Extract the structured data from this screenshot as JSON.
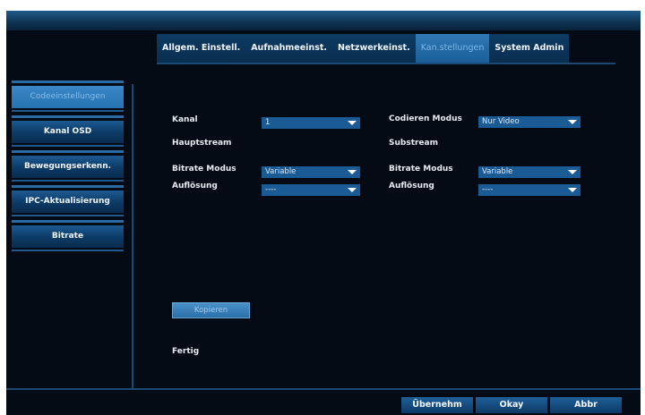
{
  "tabs": [
    {
      "label": "Allgem. Einstell."
    },
    {
      "label": "Aufnahmeeinst."
    },
    {
      "label": "Netzwerkeinst."
    },
    {
      "label": "Kan.stellungen",
      "active": true
    },
    {
      "label": "System Admin"
    }
  ],
  "sidebar": {
    "items": [
      {
        "label": "Codeeinstellungen",
        "active": true
      },
      {
        "label": "Kanal OSD"
      },
      {
        "label": "Bewegungserkenn."
      },
      {
        "label": "IPC-Aktualisierung"
      },
      {
        "label": "Bitrate"
      }
    ]
  },
  "form": {
    "kanal_label": "Kanal",
    "kanal_value": "1",
    "codieren_modus_label": "Codieren Modus",
    "codieren_modus_value": "Nur Video",
    "hauptstream_label": "Hauptstream",
    "substream_label": "Substream",
    "main_bitrate_modus_label": "Bitrate Modus",
    "main_bitrate_modus_value": "Variable",
    "sub_bitrate_modus_label": "Bitrate Modus",
    "sub_bitrate_modus_value": "Variable",
    "main_aufloesung_label": "Auflösung",
    "main_aufloesung_value": "----",
    "sub_aufloesung_label": "Auflösung",
    "sub_aufloesung_value": "----"
  },
  "copy_button": "Kopieren",
  "status_text": "Fertig",
  "footer": {
    "apply": "Übernehm",
    "ok": "Okay",
    "cancel": "Abbr"
  },
  "colors": {
    "background": "#040b14",
    "active_tab": "#2f79b5",
    "select_bg": "#1a5b95",
    "accent_line": "#1a4a73"
  }
}
